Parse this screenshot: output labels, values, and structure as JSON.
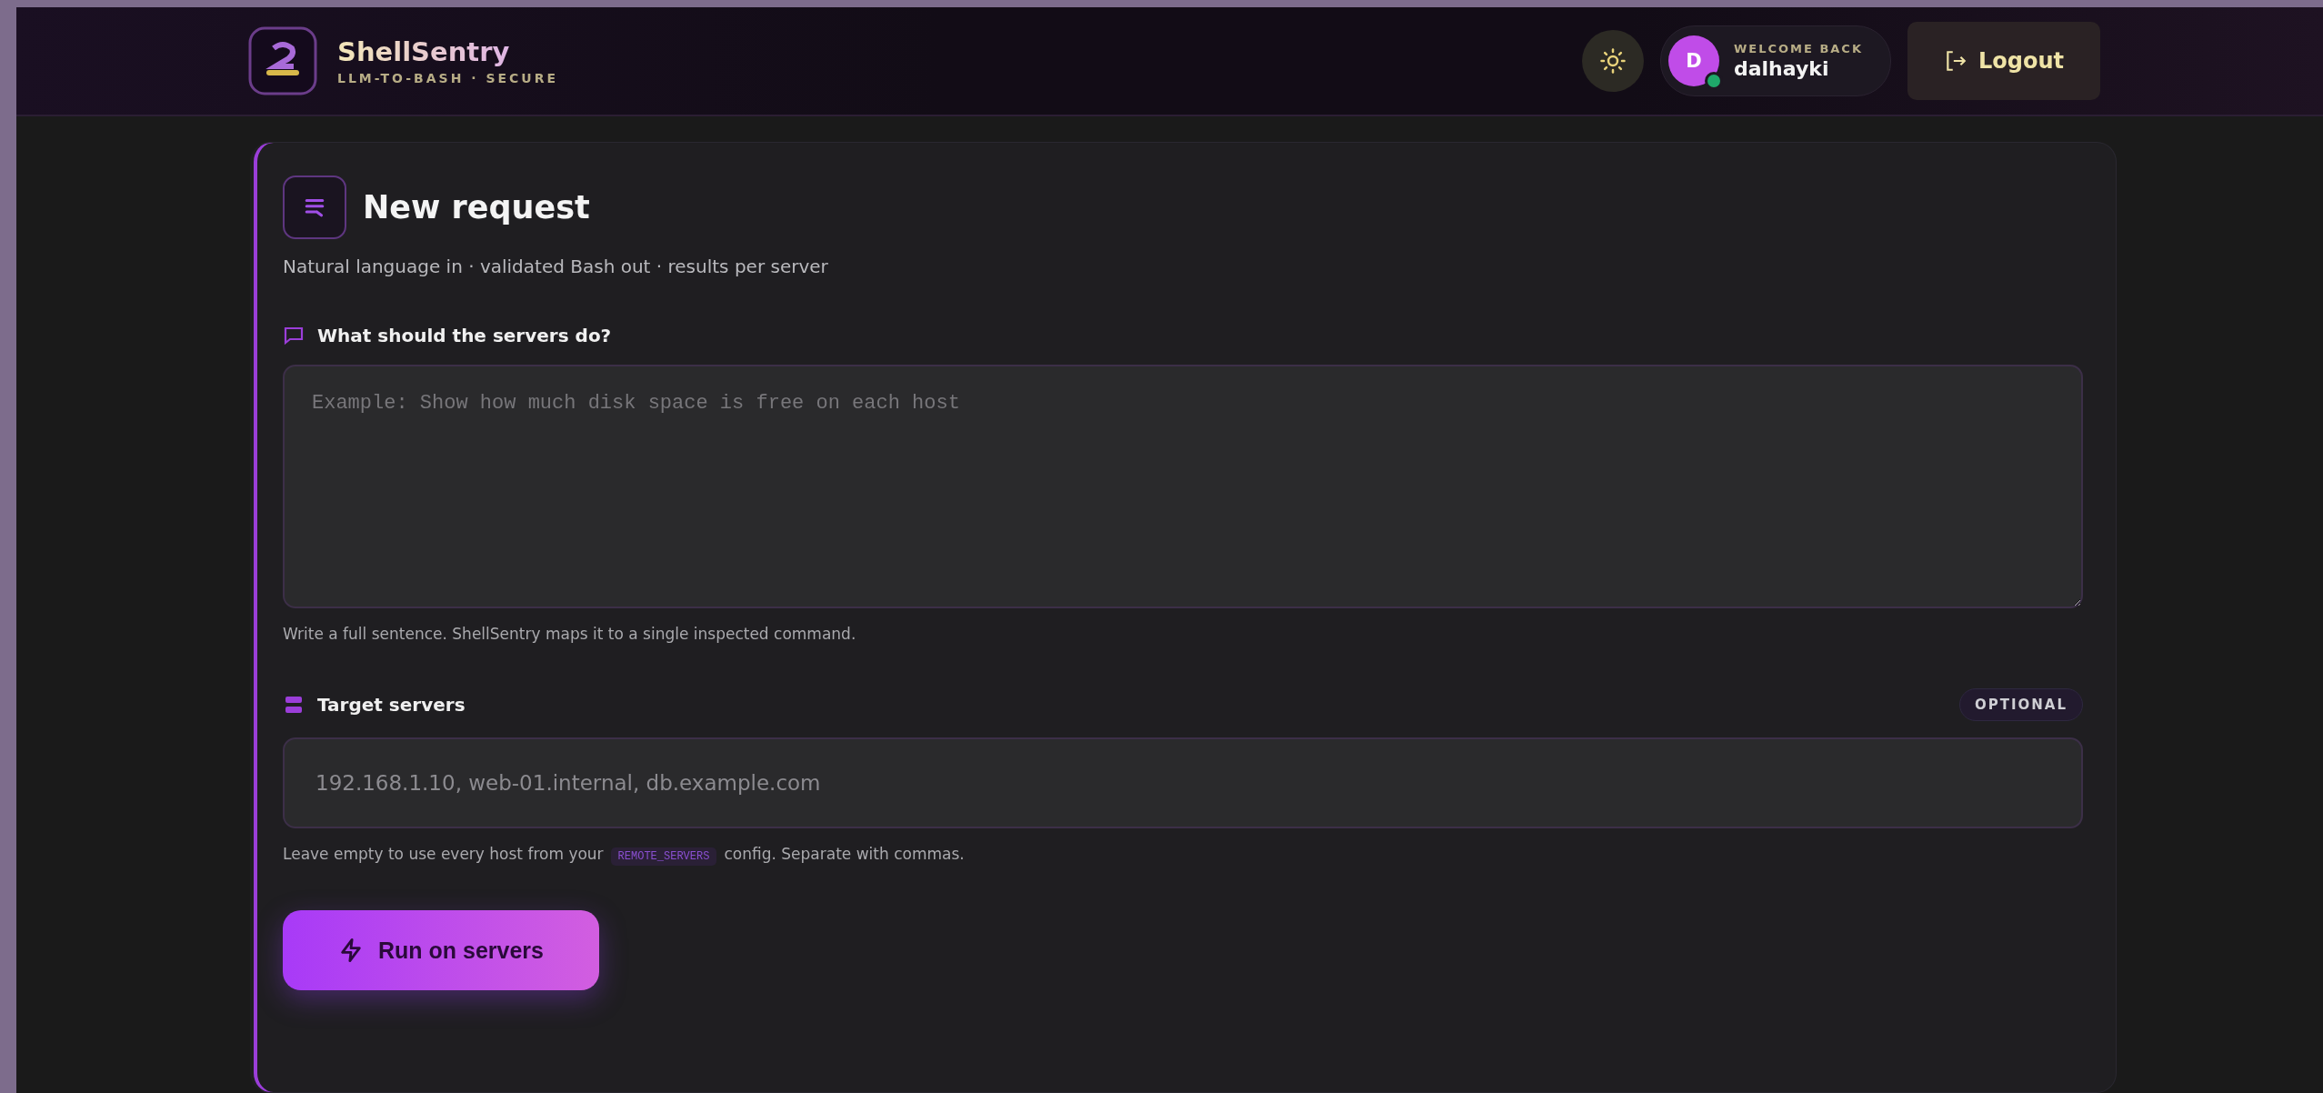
{
  "header": {
    "brand": "ShellSentry",
    "tagline": "LLM-TO-BASH · SECURE",
    "user": {
      "welcome": "WELCOME BACK",
      "name": "dalhayki",
      "initial": "D",
      "online": true
    },
    "logout": "Logout"
  },
  "card": {
    "title": "New request",
    "subtitle": "Natural language in · validated Bash out · results per server",
    "request": {
      "label": "What should the servers do?",
      "placeholder": "Example: Show how much disk space is free on each host",
      "hint": "Write a full sentence. ShellSentry maps it to a single inspected command."
    },
    "servers": {
      "label": "Target servers",
      "badge": "OPTIONAL",
      "placeholder": "192.168.1.10, web-01.internal, db.example.com",
      "hint_before": "Leave empty to use every host from your",
      "hint_code": "REMOTE_SERVERS",
      "hint_after": "config. Separate with commas."
    },
    "run_button": "Run on servers"
  }
}
